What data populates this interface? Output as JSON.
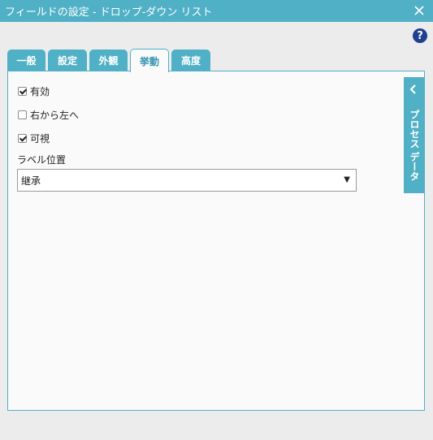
{
  "window": {
    "title": "フィールドの設定 - ドロップ-ダウン リスト"
  },
  "help": {
    "glyph": "?"
  },
  "tabs": [
    {
      "label": "一般",
      "active": false
    },
    {
      "label": "設定",
      "active": false
    },
    {
      "label": "外観",
      "active": false
    },
    {
      "label": "挙動",
      "active": true
    },
    {
      "label": "高度",
      "active": false
    }
  ],
  "behavior": {
    "enabled": {
      "label": "有効",
      "checked": true
    },
    "rtl": {
      "label": "右から左へ",
      "checked": false
    },
    "visible": {
      "label": "可視",
      "checked": true
    },
    "label_position": {
      "label": "ラベル位置",
      "value": "継承"
    }
  },
  "side_panel": {
    "label": "プロセス データ"
  },
  "colors": {
    "accent": "#50b0c6",
    "help": "#1f3f8f"
  }
}
